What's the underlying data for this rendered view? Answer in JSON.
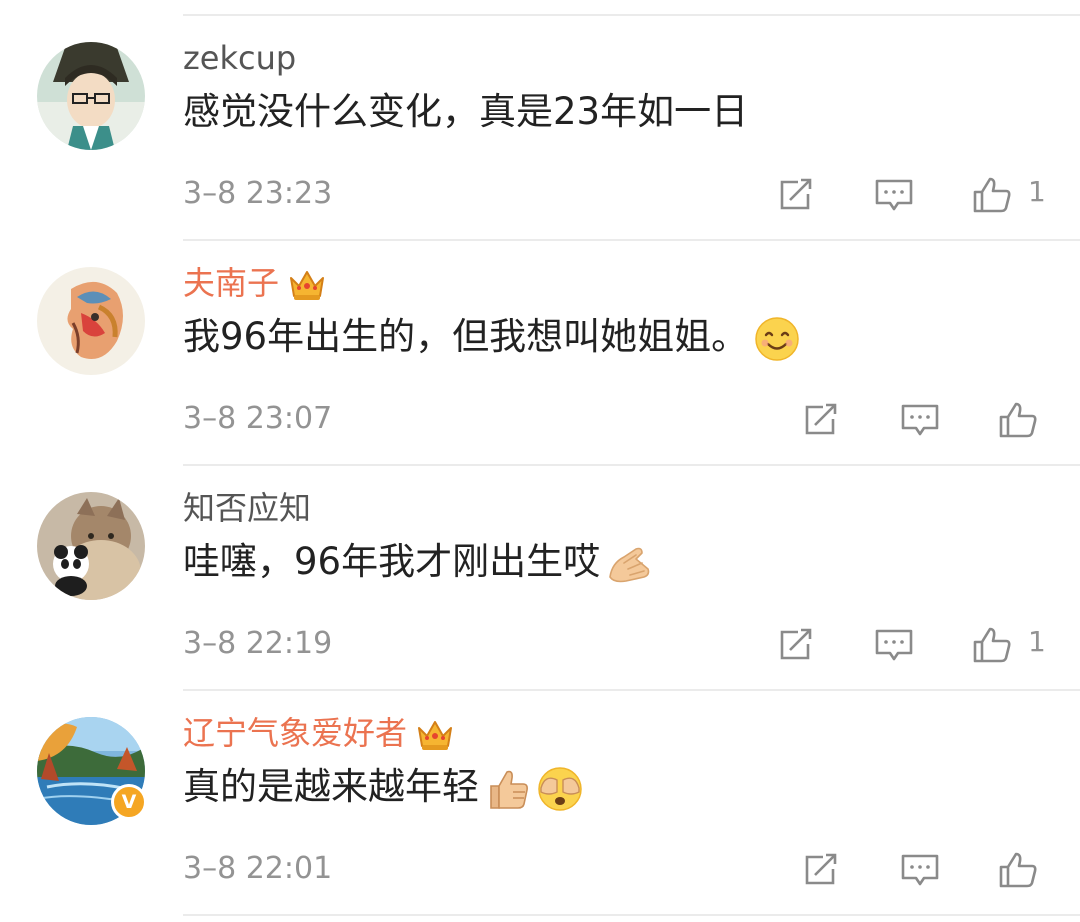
{
  "comments": [
    {
      "username": "zekcup",
      "vip": false,
      "verified": false,
      "text": "感觉没什么变化，真是23年如一日",
      "time": "3–8 23:23",
      "like_count": "1",
      "emojis": []
    },
    {
      "username": "夫南子",
      "vip": true,
      "verified": false,
      "text": "我96年出生的，但我想叫她姐姐。",
      "time": "3–8 23:07",
      "like_count": "",
      "emojis": [
        "smiling-face-emoji"
      ]
    },
    {
      "username": "知否应知",
      "vip": false,
      "verified": false,
      "text": "哇噻，96年我才刚出生哎",
      "time": "3–8 22:19",
      "like_count": "1",
      "emojis": [
        "pinched-fingers-emoji"
      ]
    },
    {
      "username": "辽宁气象爱好者",
      "vip": true,
      "verified": true,
      "text": "真的是越来越年轻",
      "time": "3–8 22:01",
      "like_count": "",
      "emojis": [
        "thumbs-up-emoji",
        "covering-eyes-emoji"
      ]
    }
  ],
  "icons": {
    "repost": "repost-icon",
    "reply": "comment-icon",
    "like": "thumbs-up-icon",
    "vip_badge": "crown-icon",
    "verified_badge": "verified-v-icon"
  },
  "colors": {
    "vip_name": "#eb7350",
    "normal_name": "#555555",
    "text": "#222222",
    "meta": "#939393",
    "divider": "#ebebeb",
    "verified": "#f5a623"
  },
  "verified_badge_label": "V"
}
